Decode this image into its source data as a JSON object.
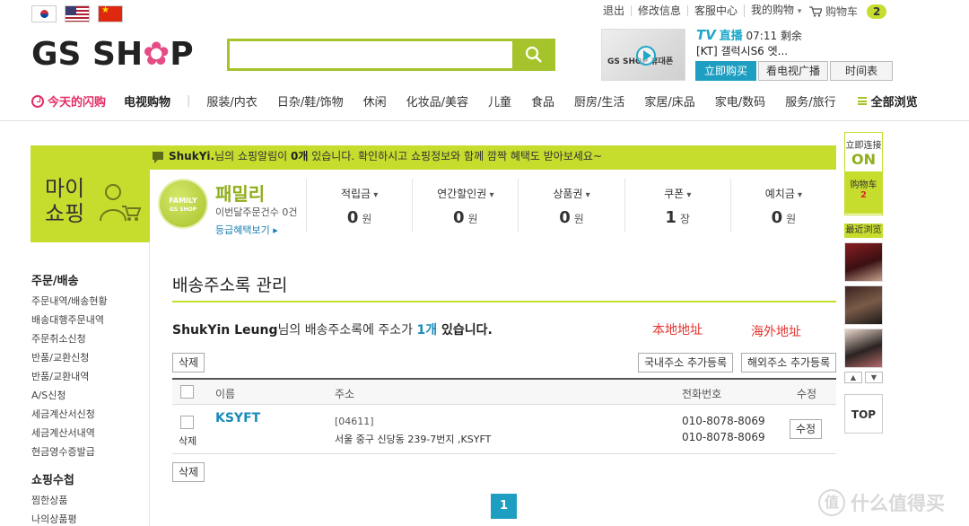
{
  "top": {
    "links": [
      "退出",
      "修改信息",
      "客服中心",
      "我的购物"
    ],
    "my_shopping_caret": "▾",
    "cart_label": "购物车",
    "cart_count": "2"
  },
  "logo": {
    "part1": "GS SH",
    "flower": "✿",
    "part2": "P"
  },
  "search": {
    "value": "",
    "placeholder": ""
  },
  "tv": {
    "thumb_text": "GS SHOP 휴대폰",
    "tv_mark": "TV",
    "live_label": "直播",
    "remaining": "07:11 剩余",
    "product": "[KT] 갤럭시S6 엣...",
    "buy_now": "立即购买",
    "watch": "看电视广播",
    "schedule": "时间表"
  },
  "nav": {
    "flash": "今天的闪购",
    "tvshop": "电视购物",
    "sep": "|",
    "categories": [
      "服装/内衣",
      "日杂/鞋/饰物",
      "休闲",
      "化妆品/美容",
      "儿童",
      "食品",
      "厨房/生活",
      "家居/床品",
      "家电/数码",
      "服务/旅行"
    ],
    "all": "全部浏览"
  },
  "banner": {
    "notice_user": "ShukYi.",
    "notice_text": "님의 쇼핑알림이 ",
    "notice_count": "0개",
    "notice_rest": " 있습니다. 확인하시고 쇼핑정보와 함께 깜짝 혜택도 받아보세요~",
    "title_line1": "마이",
    "title_line2": "쇼핑",
    "badge_line1": "FAMILY",
    "badge_line2": "GS SHOP",
    "grade": "패밀리",
    "grade_sub": "이번달주문건수 0건",
    "grade_link": "등급혜택보기 ▸",
    "stats": [
      {
        "label": "적립금",
        "value": "0",
        "unit": "원"
      },
      {
        "label": "연간할인권",
        "value": "0",
        "unit": "원"
      },
      {
        "label": "상품권",
        "value": "0",
        "unit": "원"
      },
      {
        "label": "쿠폰",
        "value": "1",
        "unit": "장"
      },
      {
        "label": "예치금",
        "value": "0",
        "unit": "원"
      }
    ]
  },
  "sidebar": {
    "section1": "주문/배송",
    "items1": [
      "주문내역/배송현황",
      "배송대행주문내역",
      "주문취소신청",
      "반품/교환신청",
      "반품/교환내역",
      "A/S신청",
      "세금계산서신청",
      "세금계산서내역",
      "현금영수증발급"
    ],
    "section2": "쇼핑수첩",
    "items2": [
      "찜한상품",
      "나의상품평"
    ]
  },
  "content": {
    "title": "배송주소록 관리",
    "summary_user": "ShukYin Leung",
    "summary_mid": "님의 배송주소록에 주소가 ",
    "summary_count": "1개",
    "summary_end": " 있습니다.",
    "note_local": "本地地址",
    "note_overseas": "海外地址",
    "delete": "삭제",
    "add_domestic": "국내주소 추가등록",
    "add_overseas": "해외주소 추가등록",
    "columns": [
      "이름",
      "주소",
      "전화번호",
      "수정"
    ],
    "row": {
      "name": "KSYFT",
      "zip": "[04611]",
      "address": "서울 중구 신당동 239-7번지 ,KSYFT",
      "tel1": "010-8078-8069",
      "tel2": "010-8078-8069",
      "edit": "수정",
      "delete": "삭제"
    },
    "page": "1"
  },
  "rail": {
    "on_label": "立即连接",
    "on_state": "ON",
    "cart_label": "购物车",
    "cart_count": "2",
    "recent": "最近浏览",
    "up": "▲",
    "down": "▼",
    "top": "TOP"
  },
  "watermark": {
    "icon": "值",
    "text": "什么值得买"
  }
}
